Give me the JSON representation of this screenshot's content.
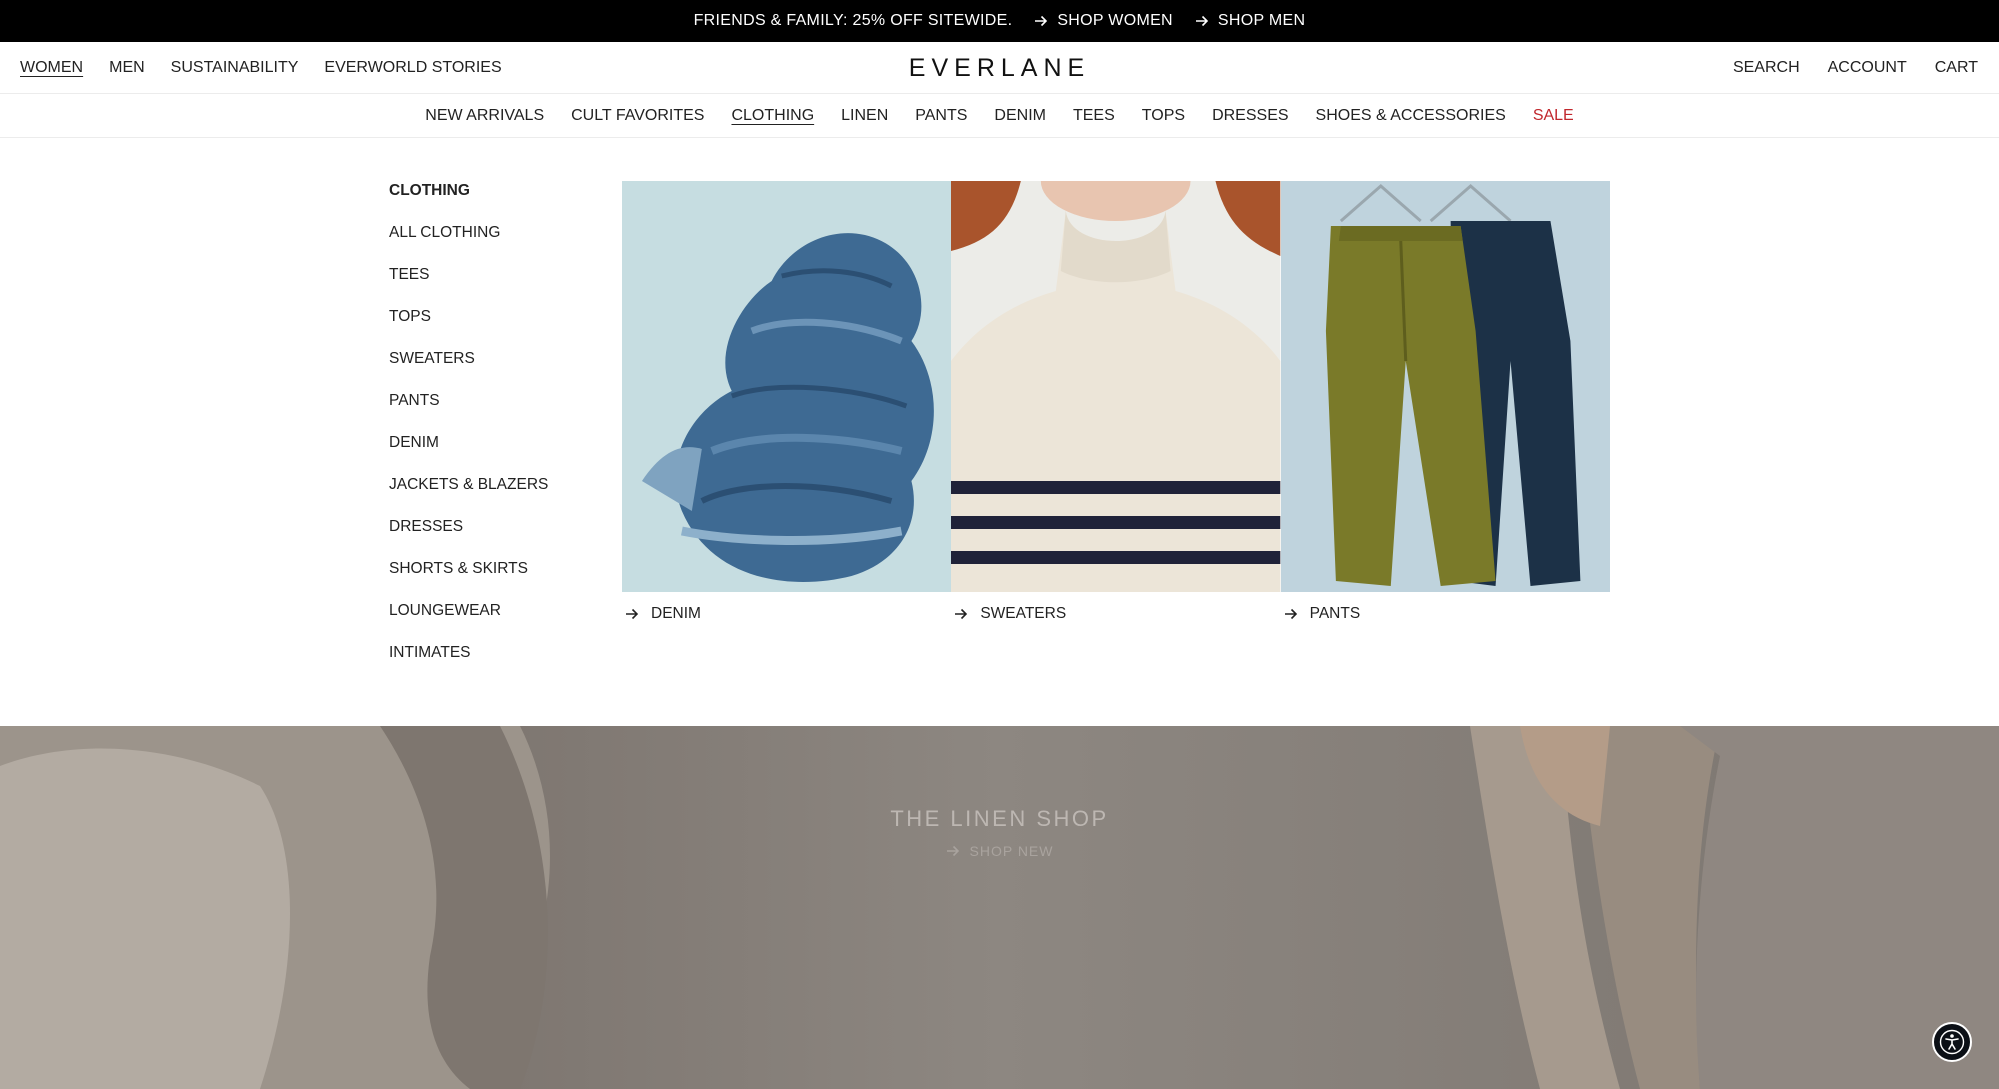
{
  "promo": {
    "text": "FRIENDS & FAMILY: 25% OFF SITEWIDE.",
    "links": [
      "SHOP WOMEN",
      "SHOP MEN"
    ]
  },
  "header": {
    "left_nav": [
      "WOMEN",
      "MEN",
      "SUSTAINABILITY",
      "EVERWORLD STORIES"
    ],
    "logo": "EVERLANE",
    "right_nav": [
      "SEARCH",
      "ACCOUNT",
      "CART"
    ]
  },
  "category_nav": [
    "NEW ARRIVALS",
    "CULT FAVORITES",
    "CLOTHING",
    "LINEN",
    "PANTS",
    "DENIM",
    "TEES",
    "TOPS",
    "DRESSES",
    "SHOES & ACCESSORIES",
    "SALE"
  ],
  "dropdown": {
    "heading": "CLOTHING",
    "items": [
      "ALL CLOTHING",
      "TEES",
      "TOPS",
      "SWEATERS",
      "PANTS",
      "DENIM",
      "JACKETS & BLAZERS",
      "DRESSES",
      "SHORTS & SKIRTS",
      "LOUNGEWEAR",
      "INTIMATES"
    ],
    "tiles": [
      "DENIM",
      "SWEATERS",
      "PANTS"
    ]
  },
  "hero": {
    "title": "THE LINEN SHOP",
    "cta": "SHOP NEW"
  },
  "colors": {
    "promo_bg": "#000000",
    "sale": "#c1272d",
    "accessibility_button": "#0b0f16"
  },
  "icons": {
    "arrow": "arrow-right-icon",
    "accessibility": "accessibility-icon"
  }
}
